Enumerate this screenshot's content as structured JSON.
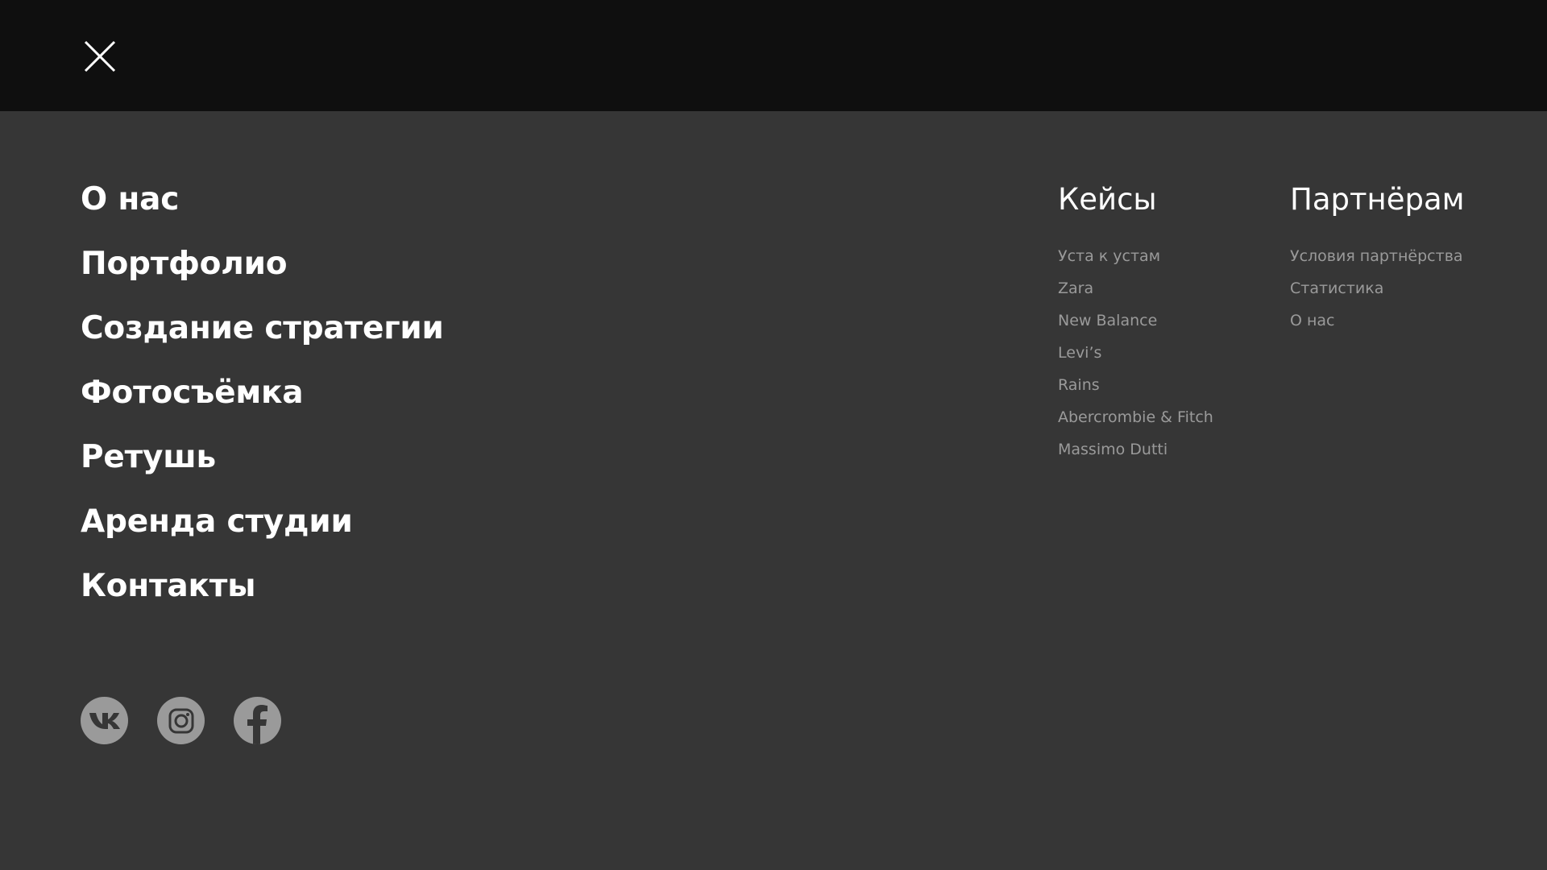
{
  "header": {
    "close_icon": "close-icon"
  },
  "nav": {
    "items": [
      {
        "label": "О нас"
      },
      {
        "label": "Портфолио"
      },
      {
        "label": "Создание стратегии"
      },
      {
        "label": "Фотосъёмка"
      },
      {
        "label": "Ретушь"
      },
      {
        "label": "Аренда студии"
      },
      {
        "label": "Контакты"
      }
    ]
  },
  "cases": {
    "title": "Кейсы",
    "items": [
      {
        "label": "Уста к устам"
      },
      {
        "label": "Zara"
      },
      {
        "label": "New Balance"
      },
      {
        "label": "Levi’s"
      },
      {
        "label": "Rains"
      },
      {
        "label": "Abercrombie & Fitch"
      },
      {
        "label": "Massimo Dutti"
      }
    ]
  },
  "partners": {
    "title": "Партнёрам",
    "items": [
      {
        "label": "Условия партнёрства"
      },
      {
        "label": "Статистика"
      },
      {
        "label": "О нас"
      }
    ]
  },
  "socials": {
    "items": [
      {
        "icon": "vk-icon"
      },
      {
        "icon": "instagram-icon"
      },
      {
        "icon": "facebook-icon"
      }
    ]
  },
  "colors": {
    "topbar_bg": "#0f0f0f",
    "panel_bg": "#363636",
    "primary_text": "#ffffff",
    "secondary_text": "#9a9a9a",
    "social_bg": "#9a9a9a"
  }
}
